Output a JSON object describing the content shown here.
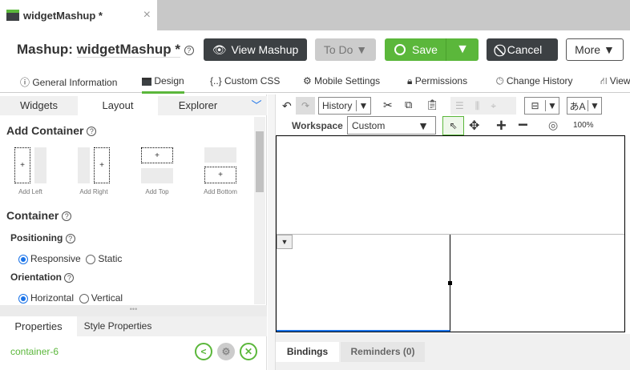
{
  "doc_tab": {
    "title": "widgetMashup *",
    "close": "×"
  },
  "header": {
    "prefix": "Mashup:",
    "name": "widgetMashup *",
    "help": "?"
  },
  "buttons": {
    "view": "View Mashup",
    "todo": "To Do",
    "save": "Save",
    "cancel": "Cancel",
    "more": "More"
  },
  "nav": [
    "General Information",
    "Design",
    "{..} Custom CSS",
    "Mobile Settings",
    "Permissions",
    "Change History",
    "View"
  ],
  "left_tabs": [
    "Widgets",
    "Layout",
    "Explorer"
  ],
  "add_container": {
    "title": "Add Container",
    "items": [
      "Add Left",
      "Add Right",
      "Add Top",
      "Add Bottom"
    ]
  },
  "container": {
    "title": "Container",
    "positioning": "Positioning",
    "pos_options": [
      "Responsive",
      "Static"
    ],
    "orientation": "Orientation",
    "orient_options": [
      "Horizontal",
      "Vertical"
    ]
  },
  "props": {
    "tabs": [
      "Properties",
      "Style Properties"
    ],
    "selected": "container-6"
  },
  "toolbar": {
    "history": "History",
    "workspace_label": "Workspace",
    "workspace": "Custom",
    "zoom": "100%"
  },
  "bottom_tabs": [
    "Bindings",
    "Reminders (0)"
  ],
  "colors": {
    "green": "#5bb73b",
    "dark": "#3c4043"
  }
}
